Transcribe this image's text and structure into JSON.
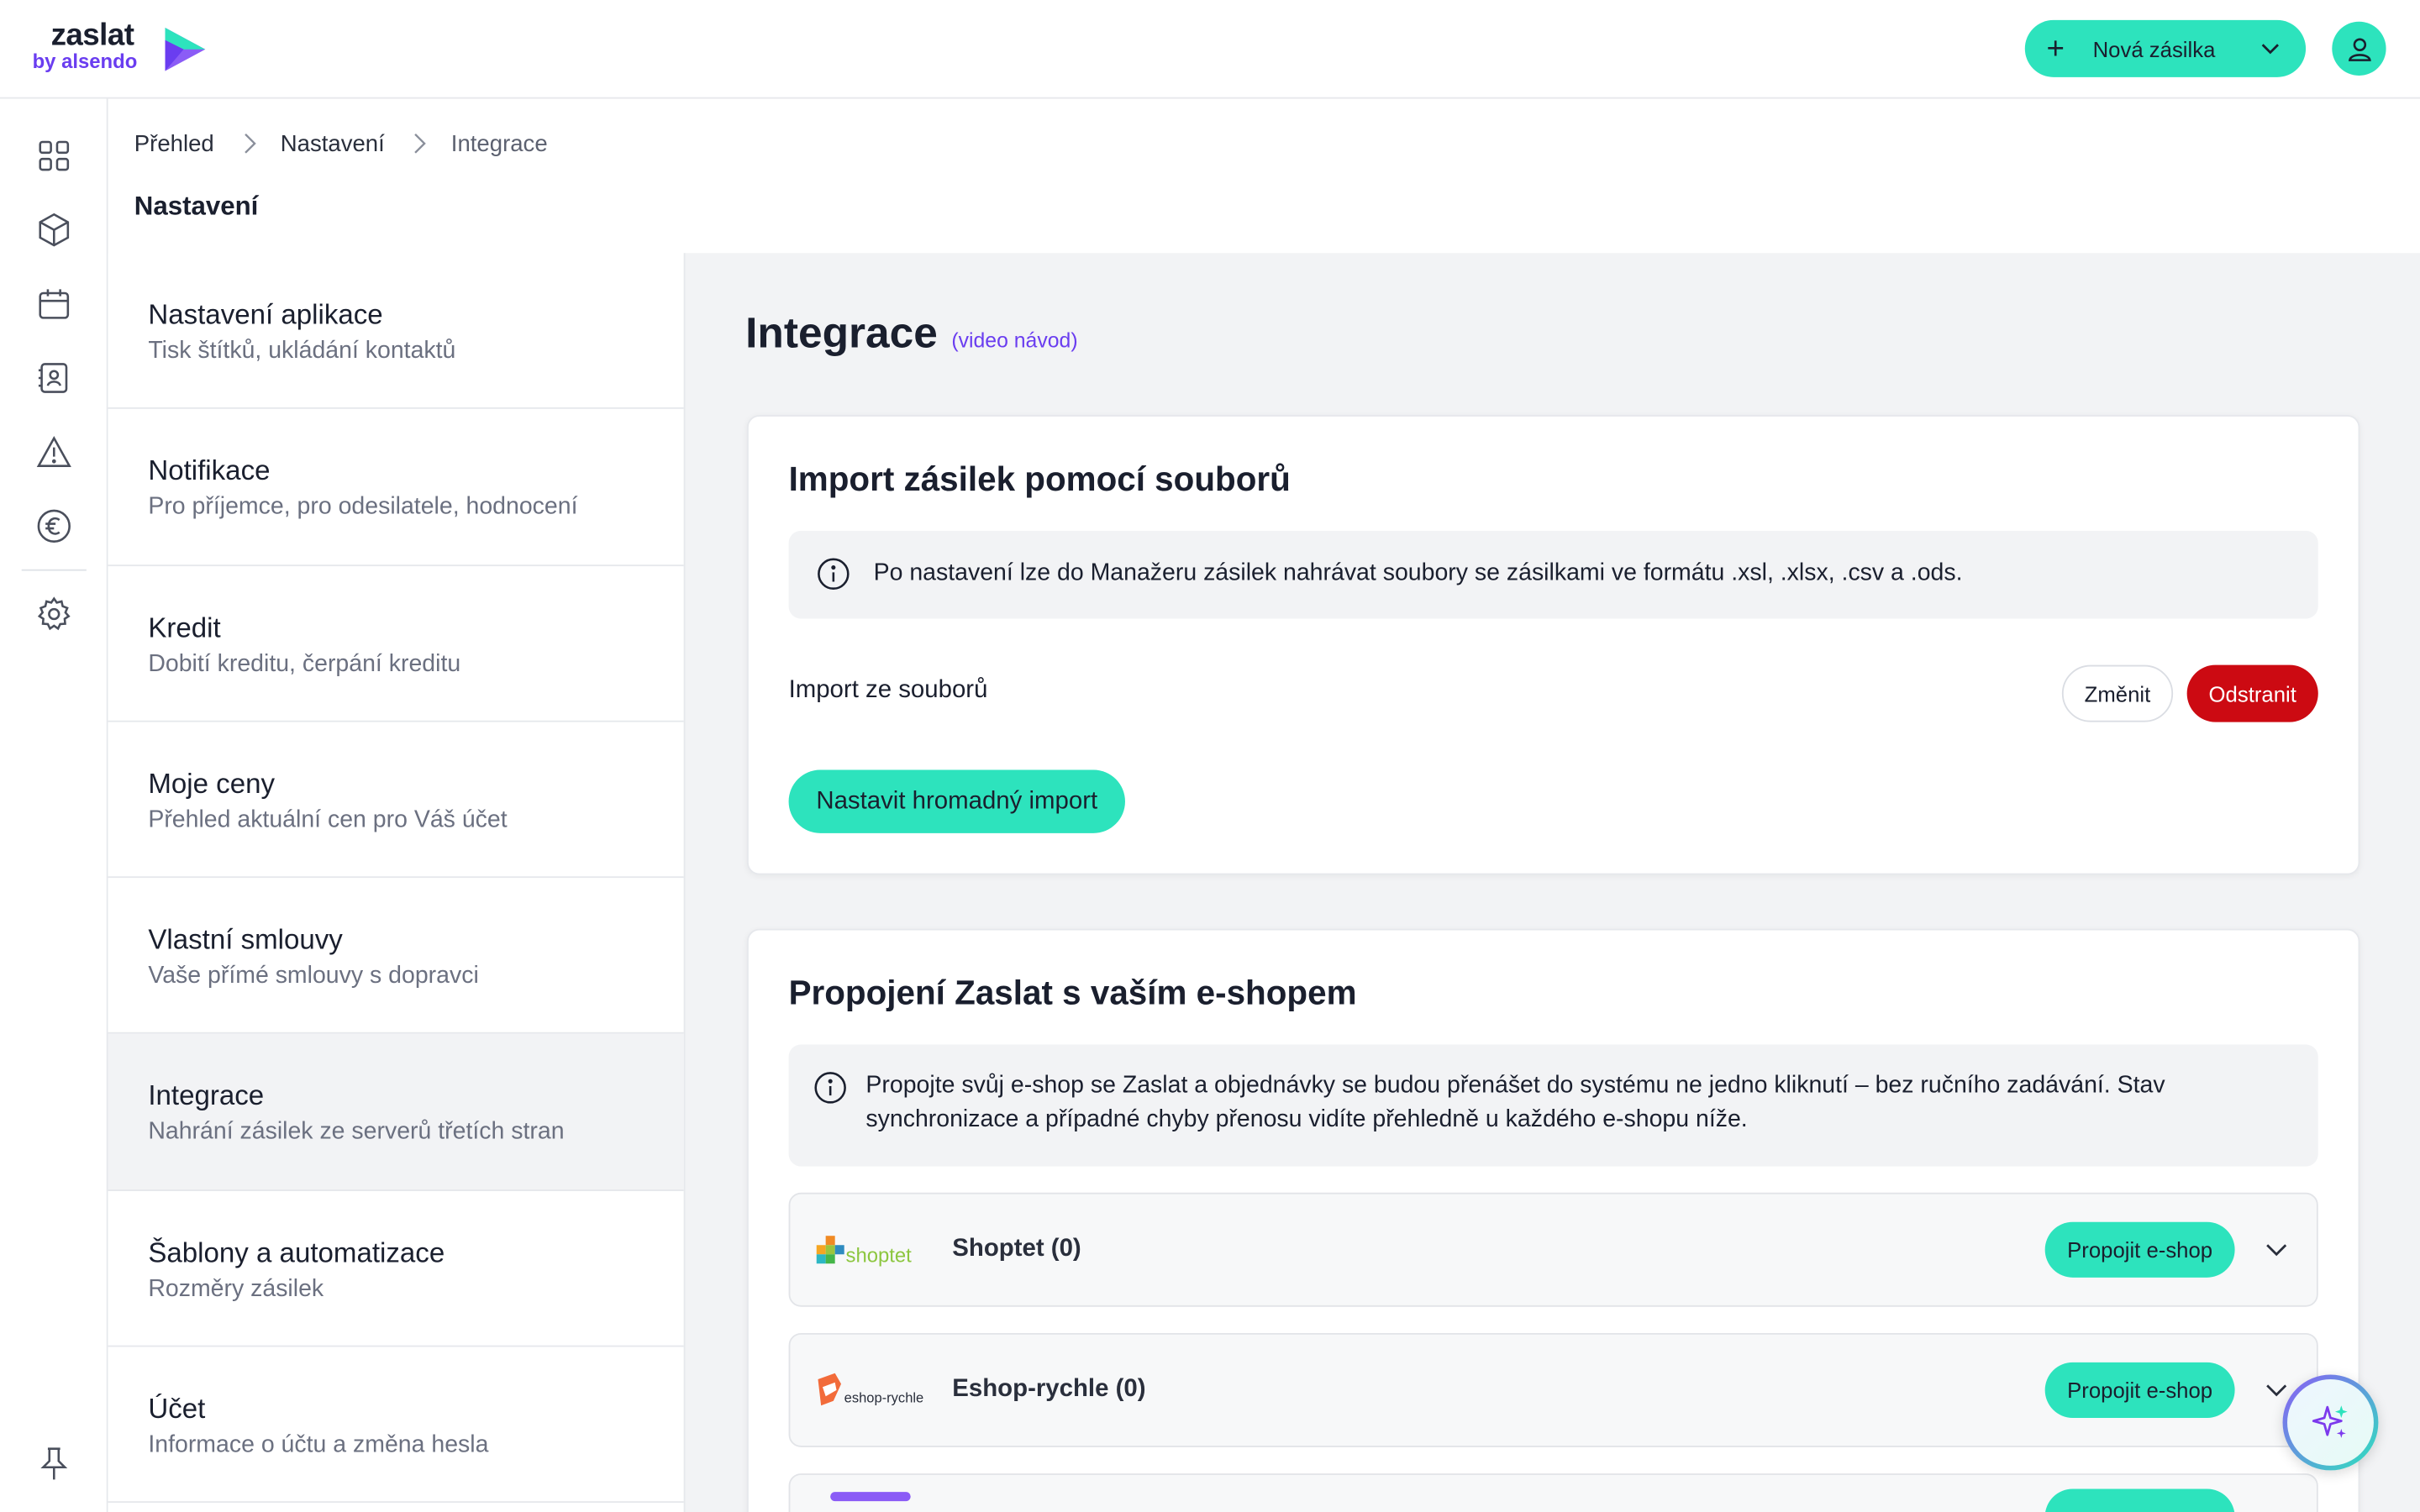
{
  "header": {
    "logo_word": "zaslat",
    "logo_by": "by alsendo",
    "new_shipment_label": "Nová zásilka"
  },
  "breadcrumb": [
    "Přehled",
    "Nastavení",
    "Integrace"
  ],
  "page_title": "Nastavení",
  "menu": [
    {
      "title": "Nastavení aplikace",
      "subtitle": "Tisk štítků, ukládání kontaktů",
      "active": false
    },
    {
      "title": "Notifikace",
      "subtitle": "Pro příjemce, pro odesilatele, hodnocení",
      "active": false
    },
    {
      "title": "Kredit",
      "subtitle": "Dobití kreditu, čerpání kreditu",
      "active": false
    },
    {
      "title": "Moje ceny",
      "subtitle": "Přehled aktuální cen pro Váš účet",
      "active": false
    },
    {
      "title": "Vlastní smlouvy",
      "subtitle": "Vaše přímé smlouvy s dopravci",
      "active": false
    },
    {
      "title": "Integrace",
      "subtitle": "Nahrání zásilek ze serverů třetích stran",
      "active": true
    },
    {
      "title": "Šablony a automatizace",
      "subtitle": "Rozměry zásilek",
      "active": false
    },
    {
      "title": "Účet",
      "subtitle": "Informace o účtu a změna hesla",
      "active": false
    }
  ],
  "main": {
    "title": "Integrace",
    "video_link": "(video návod)",
    "import_card": {
      "title": "Import zásilek pomocí souborů",
      "info": "Po nastavení lze do Manažeru zásilek nahrávat soubory se zásilkami ve formátu .xsl, .xlsx, .csv a .ods.",
      "row_label": "Import ze souborů",
      "change_label": "Změnit",
      "remove_label": "Odstranit",
      "setup_label": "Nastavit hromadný import"
    },
    "eshop_card": {
      "title": "Propojení Zaslat s vaším e-shopem",
      "info": "Propojte svůj e-shop se Zaslat a objednávky se budou přenášet do systému ne jedno kliknutí – bez ručního zadávání. Stav synchronizace a případné chyby přenosu vidíte přehledně u každého e-shopu níže.",
      "shops": [
        {
          "name": "Shoptet (0)",
          "button": "Propojit e-shop",
          "logo": "shoptet"
        },
        {
          "name": "Eshop-rychle (0)",
          "button": "Propojit e-shop",
          "logo": "eshop-rychle"
        }
      ]
    }
  },
  "colors": {
    "accent": "#2de3bd",
    "brand_purple": "#6a3df0",
    "danger": "#cc0a12",
    "panel_bg": "#f2f3f5"
  },
  "icons": {
    "rail": [
      "dashboard-icon",
      "package-icon",
      "calendar-icon",
      "contacts-icon",
      "warning-icon",
      "euro-icon",
      "settings-icon",
      "pin-icon"
    ]
  }
}
